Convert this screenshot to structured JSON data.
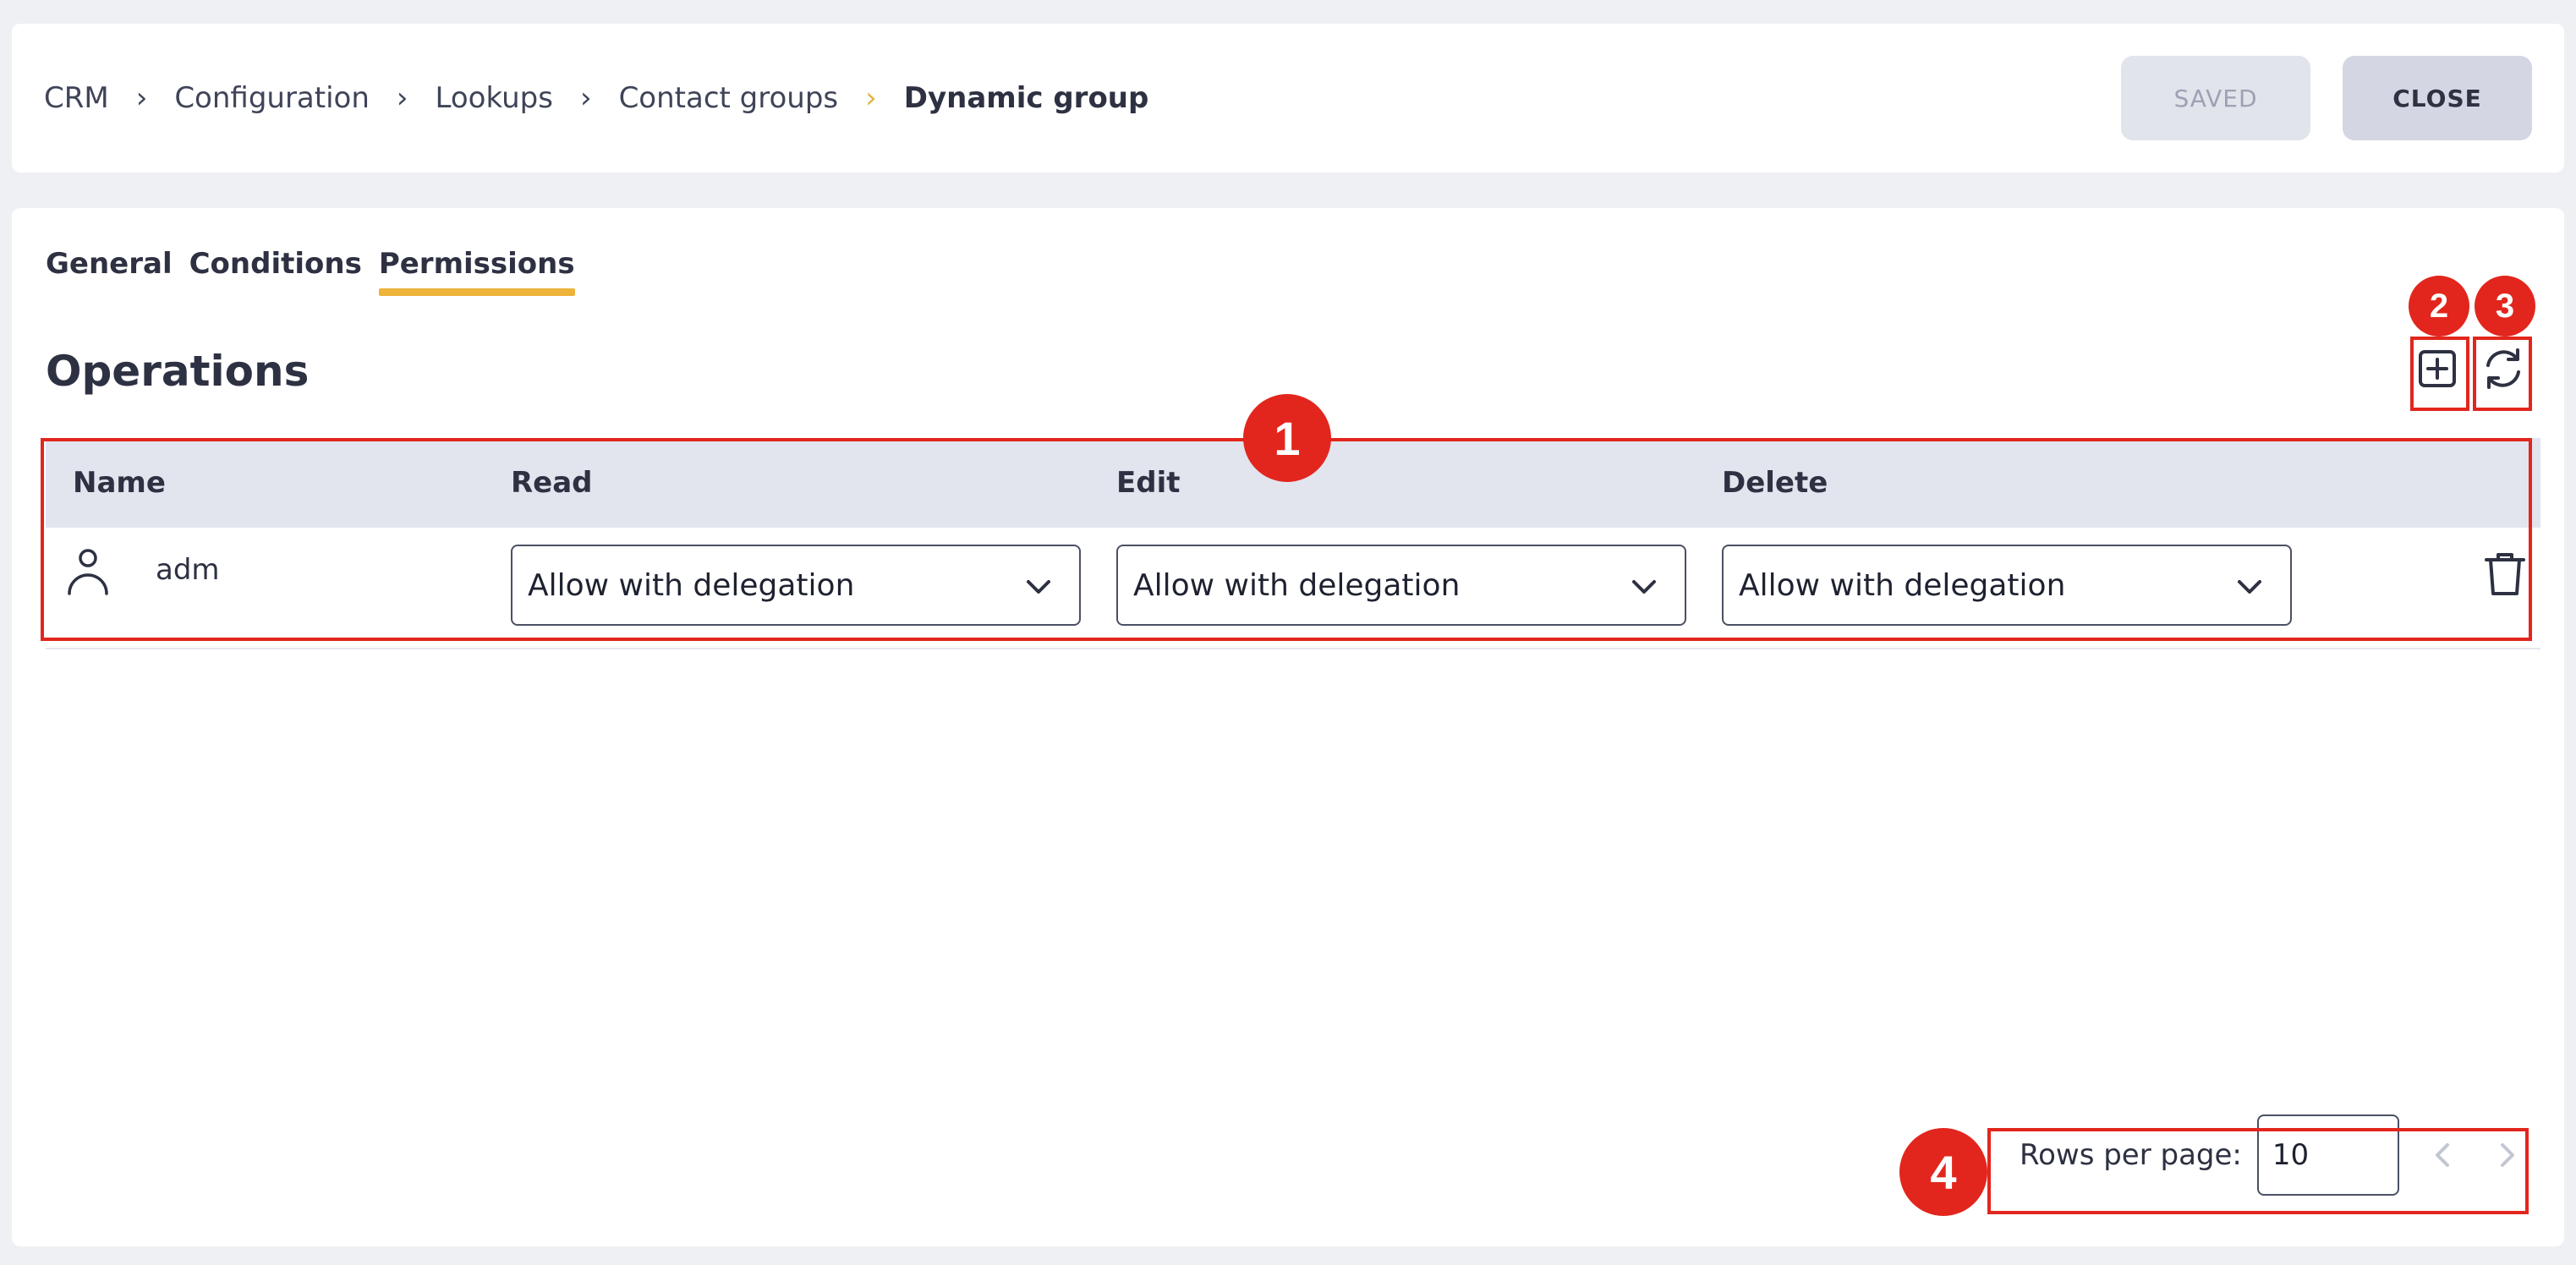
{
  "breadcrumb": {
    "items": [
      "CRM",
      "Configuration",
      "Lookups",
      "Contact groups"
    ],
    "current": "Dynamic group"
  },
  "header": {
    "saved_label": "SAVED",
    "close_label": "CLOSE"
  },
  "tabs": [
    {
      "label": "General"
    },
    {
      "label": "Conditions"
    },
    {
      "label": "Permissions",
      "active": true
    }
  ],
  "section": {
    "title": "Operations"
  },
  "table": {
    "columns": [
      "Name",
      "Read",
      "Edit",
      "Delete"
    ],
    "rows": [
      {
        "name": "adm",
        "read": "Allow with delegation",
        "edit": "Allow with delegation",
        "delete": "Allow with delegation"
      }
    ]
  },
  "pagination": {
    "rows_per_page_label": "Rows per page:",
    "rows_per_page_value": "10"
  },
  "annotations": {
    "table_badge": "1",
    "add_badge": "2",
    "refresh_badge": "3",
    "pager_badge": "4"
  },
  "colors": {
    "accent": "#edb33a",
    "annotation": "#e2261d",
    "header_bg": "#e2e4ee"
  },
  "icons": [
    "user-icon",
    "chevron-down-icon",
    "trash-icon",
    "plus-square-icon",
    "refresh-icon",
    "chevron-left-icon",
    "chevron-right-icon",
    "breadcrumb-chevron-icon"
  ]
}
